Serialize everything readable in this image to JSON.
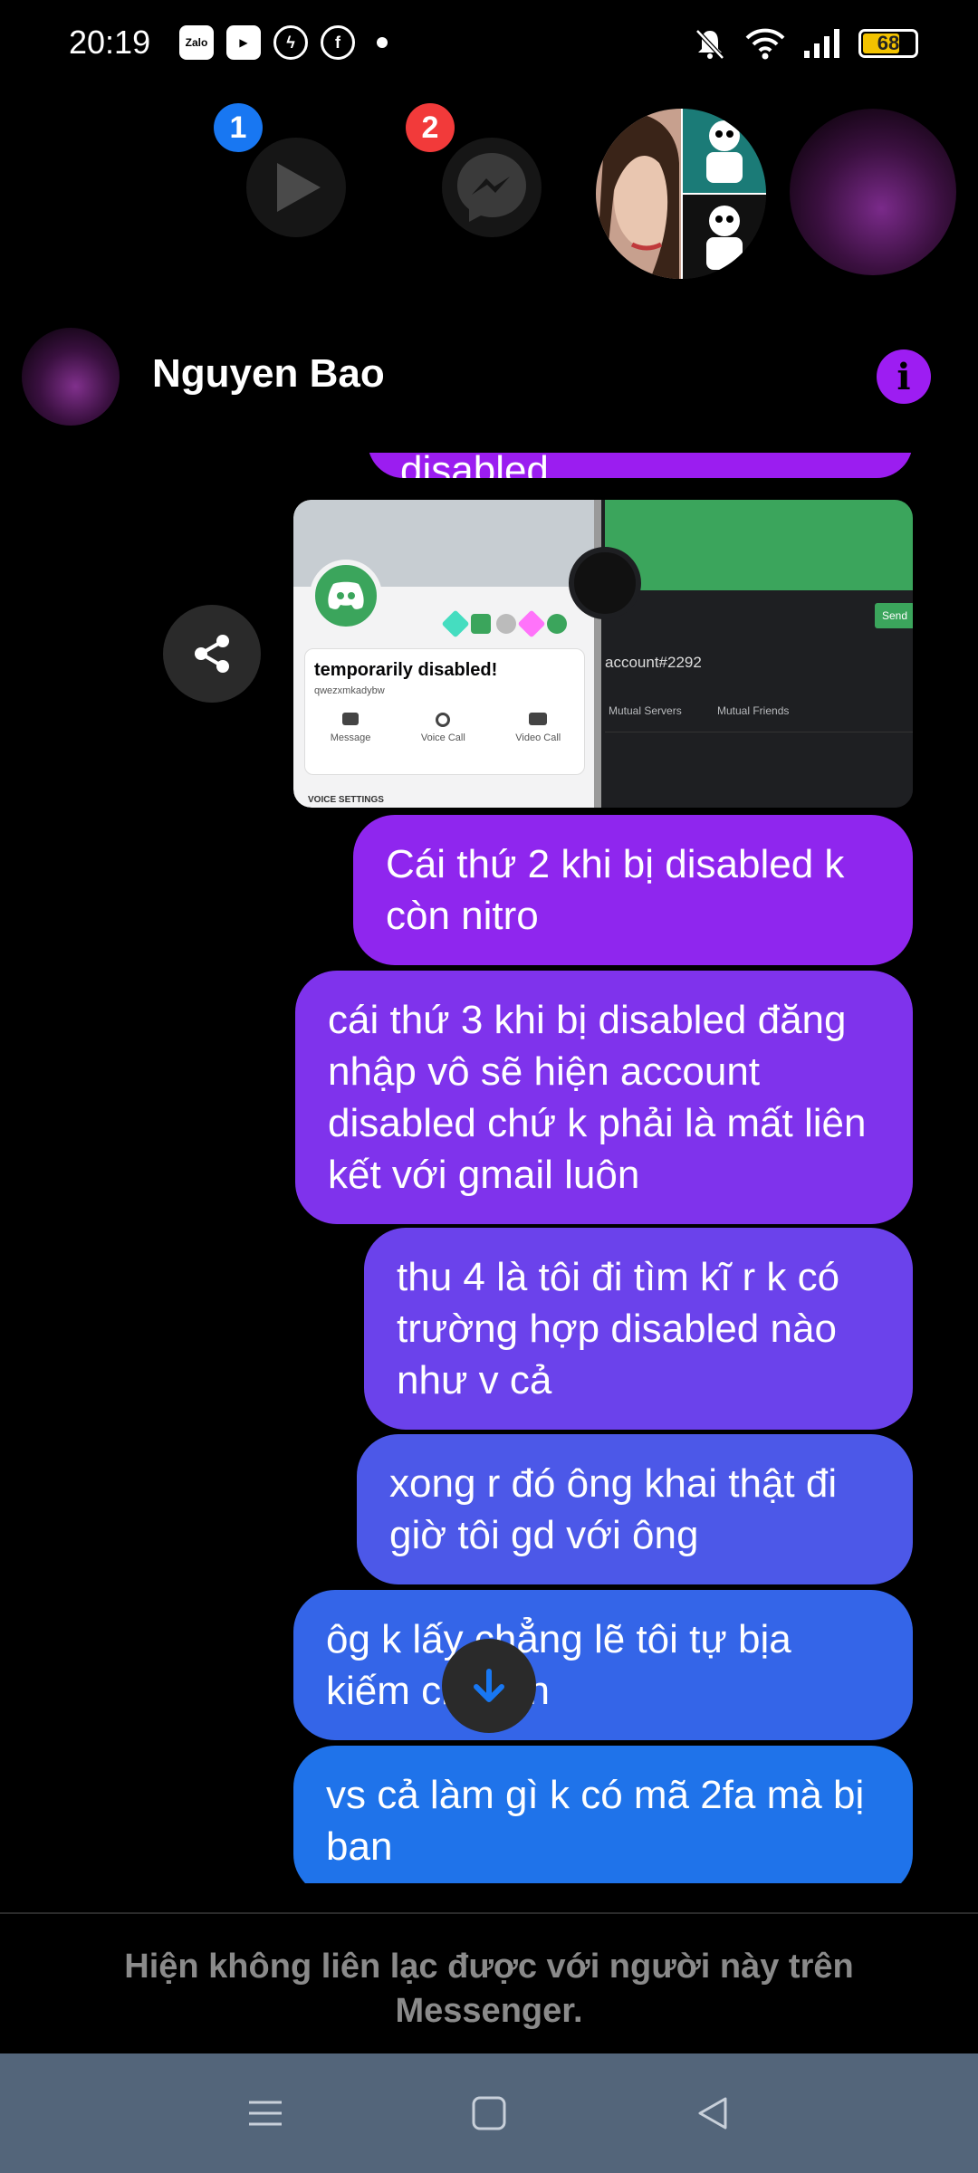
{
  "status_bar": {
    "time": "20:19",
    "battery": "68",
    "notification_icons": [
      "zalo-icon",
      "media-app-icon",
      "messenger-icon",
      "facebook-icon"
    ]
  },
  "chat_heads": {
    "badge_1": "1",
    "badge_2": "2"
  },
  "header": {
    "name": "Nguyen Bao",
    "info_label": "i"
  },
  "attachment": {
    "left_card": {
      "status": "temporarily disabled!",
      "username": "qwezxmkadybw",
      "actions": [
        "Message",
        "Voice Call",
        "Video Call"
      ],
      "footer": "VOICE SETTINGS"
    },
    "right_card": {
      "account": "account#2292",
      "send_label": "Send",
      "tabs": [
        "Mutual Servers",
        "Mutual Friends"
      ]
    }
  },
  "messages": [
    {
      "text": "disabled"
    },
    {
      "text": "Cái thứ 2 khi bị disabled k còn nitro"
    },
    {
      "text": "cái thứ 3 khi bị disabled đăng nhập vô sẽ hiện account disabled chứ k phải là mất liên kết với gmail luôn"
    },
    {
      "text": "thu 4 là tôi đi tìm kĩ r k có trường hợp disabled nào như v cả"
    },
    {
      "text": "xong r đó ông khai thật đi giờ tôi gd với ông"
    },
    {
      "text": "ôg k lấy chẳng lẽ tôi tự bịa kiếm chuyện"
    },
    {
      "text": "vs cả làm gì k có mã 2fa mà bị ban"
    }
  ],
  "footer_notice": "Hiện không liên lạc được với người này trên Messenger.",
  "colors": {
    "bubble_purple": "#8f26ee",
    "bubble_blue": "#1f73ea",
    "badge_blue": "#1877f2",
    "badge_red": "#f23a3a",
    "navbar": "#53657a"
  }
}
